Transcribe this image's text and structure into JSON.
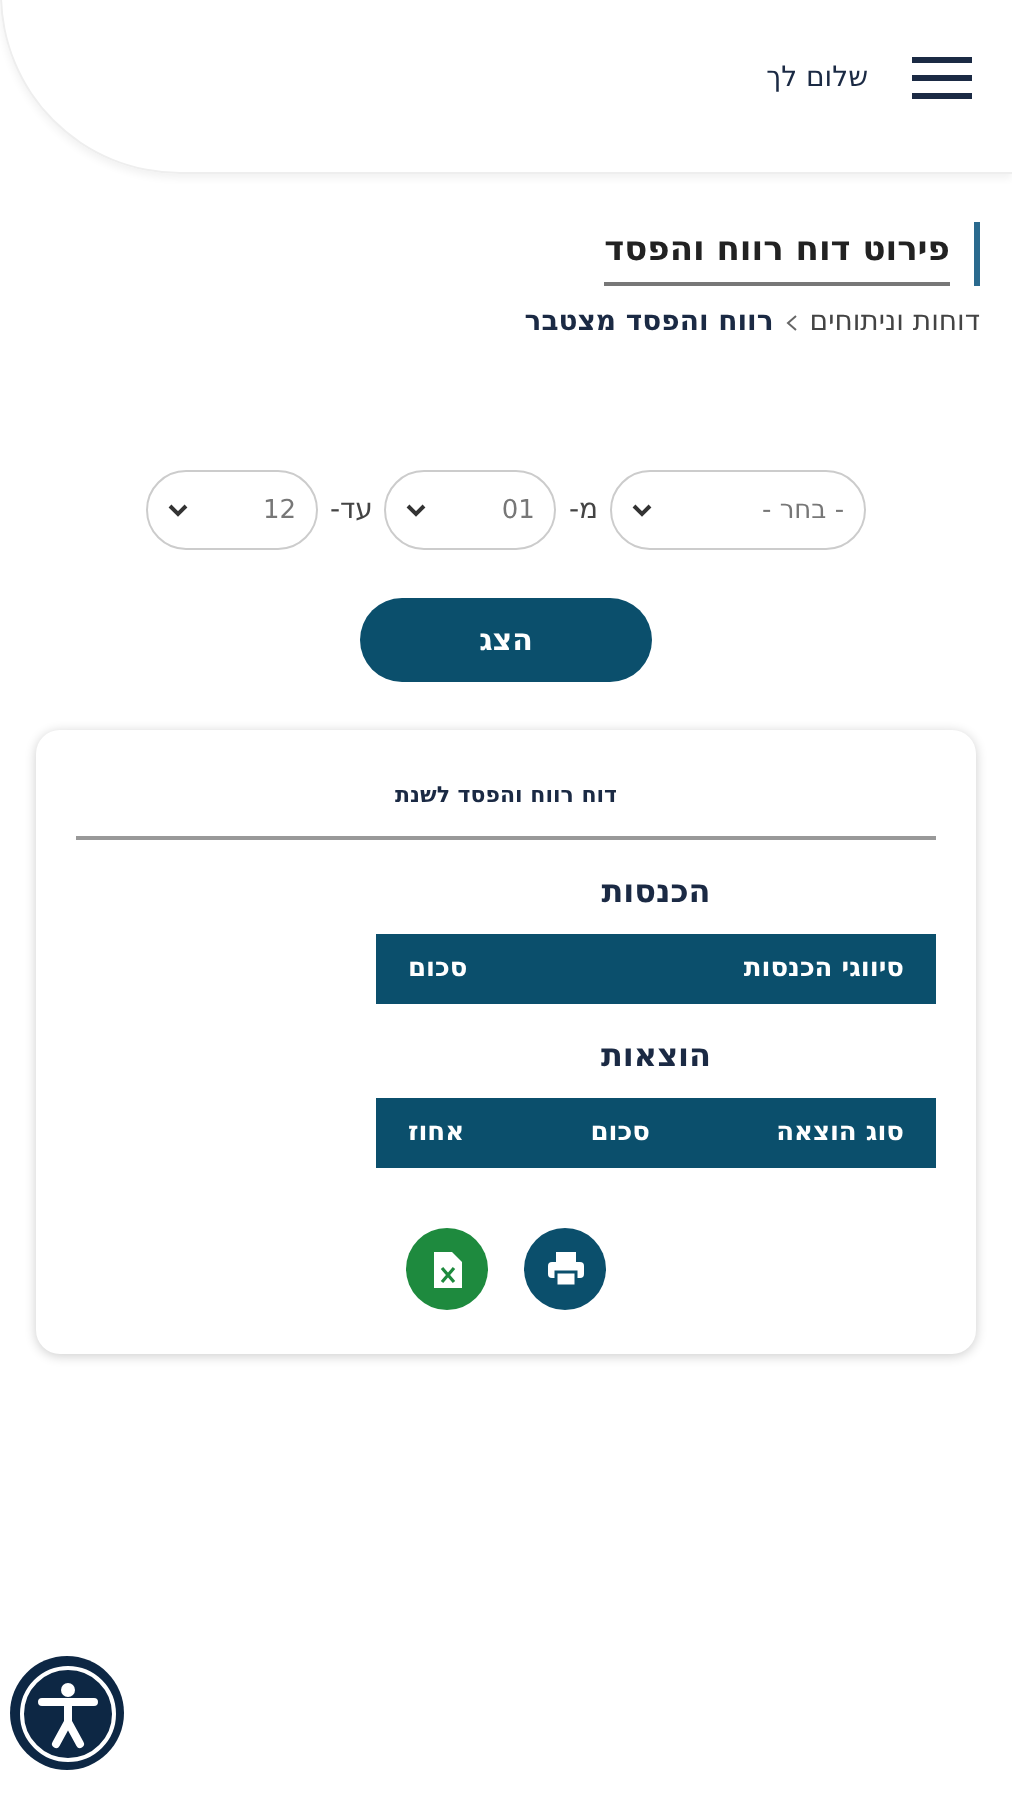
{
  "header": {
    "greeting": "שלום לך"
  },
  "page": {
    "title": "פירוט דוח רווח והפסד",
    "breadcrumb": [
      "דוחות וניתוחים",
      "רווח והפסד מצטבר"
    ]
  },
  "filters": [
    {
      "kind": "select",
      "value": "- בחר -"
    },
    {
      "kind": "label",
      "text": "מ-"
    },
    {
      "kind": "select",
      "value": "01"
    },
    {
      "kind": "label",
      "text": "עד-"
    },
    {
      "kind": "select",
      "value": "12"
    }
  ],
  "show_button": "הצג",
  "report": {
    "title": "דוח רווח והפסד לשנת",
    "sections": [
      {
        "heading": "הכנסות",
        "columns": [
          "סיווגי הכנסות",
          "סכום"
        ]
      },
      {
        "heading": "הוצאות",
        "columns": [
          "סוג הוצאה",
          "סכום",
          "אחוז"
        ]
      }
    ],
    "actions": [
      {
        "kind": "print"
      },
      {
        "kind": "excel"
      }
    ]
  }
}
